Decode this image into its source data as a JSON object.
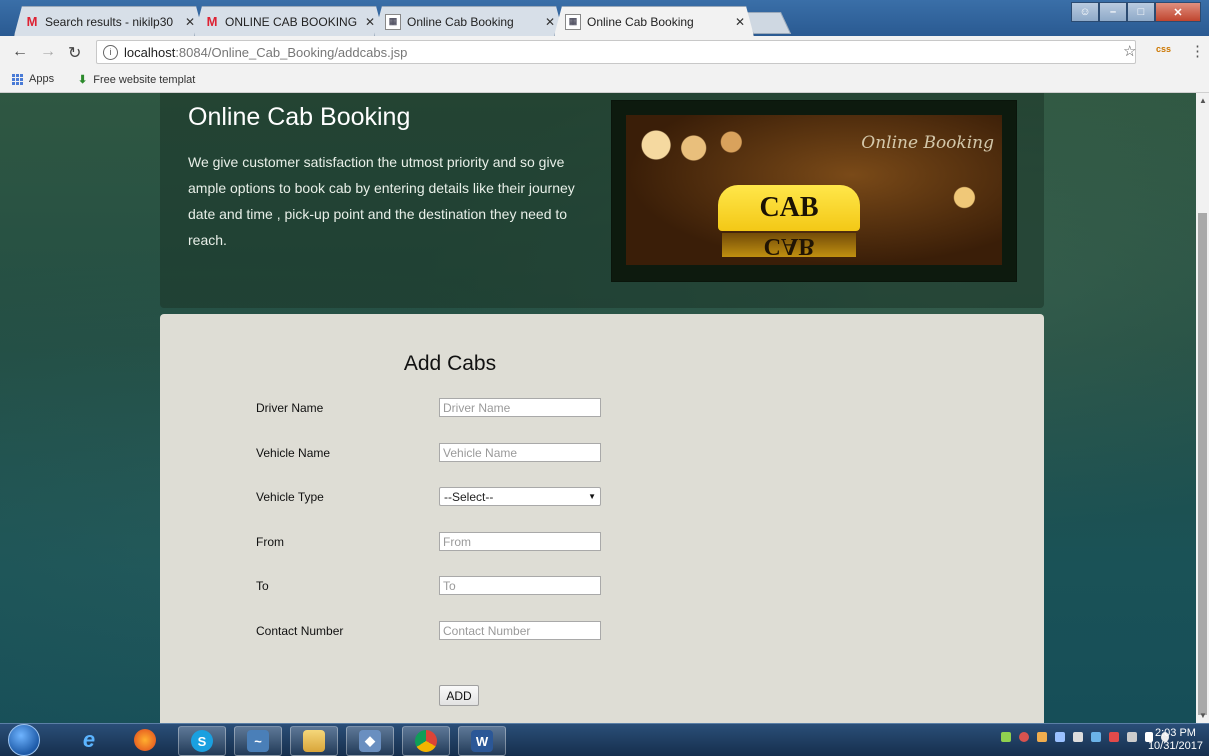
{
  "browser": {
    "tabs": [
      {
        "title": "Search results - nikilp30",
        "favicon": "gmail-icon",
        "active": false
      },
      {
        "title": "ONLINE CAB BOOKING -",
        "favicon": "gmail-icon",
        "active": false
      },
      {
        "title": "Online Cab Booking",
        "favicon": "page-icon",
        "active": false
      },
      {
        "title": "Online Cab Booking",
        "favicon": "page-icon",
        "active": true
      }
    ],
    "url_host": "localhost",
    "url_path": ":8084/Online_Cab_Booking/addcabs.jsp",
    "bookmarks": [
      {
        "label": "Apps",
        "icon": "apps-grid-icon"
      },
      {
        "label": "Free website templat",
        "icon": "download-icon"
      }
    ],
    "extension_label": "css"
  },
  "hero": {
    "title": "Online Cab Booking",
    "description": "We give customer satisfaction the utmost priority and so give ample options to book cab by entering details like their journey date and time , pick-up point and the destination they need to reach.",
    "image_script_text": "Online Booking",
    "image_sign_text": "CAB"
  },
  "form": {
    "title": "Add Cabs",
    "fields": [
      {
        "label": "Driver Name",
        "placeholder": "Driver Name",
        "type": "text"
      },
      {
        "label": "Vehicle Name",
        "placeholder": "Vehicle Name",
        "type": "text"
      },
      {
        "label": "Vehicle Type",
        "selected": "--Select--",
        "type": "select"
      },
      {
        "label": "From",
        "placeholder": "From",
        "type": "text"
      },
      {
        "label": "To",
        "placeholder": "To",
        "type": "text"
      },
      {
        "label": "Contact Number",
        "placeholder": "Contact Number",
        "type": "text"
      }
    ],
    "submit_label": "ADD"
  },
  "taskbar": {
    "time": "2:03 PM",
    "date": "10/31/2017"
  },
  "colors": {
    "hero_bg": "#2f5742",
    "panel_bg": "#deddd5",
    "cab_sign": "#f3c816"
  }
}
